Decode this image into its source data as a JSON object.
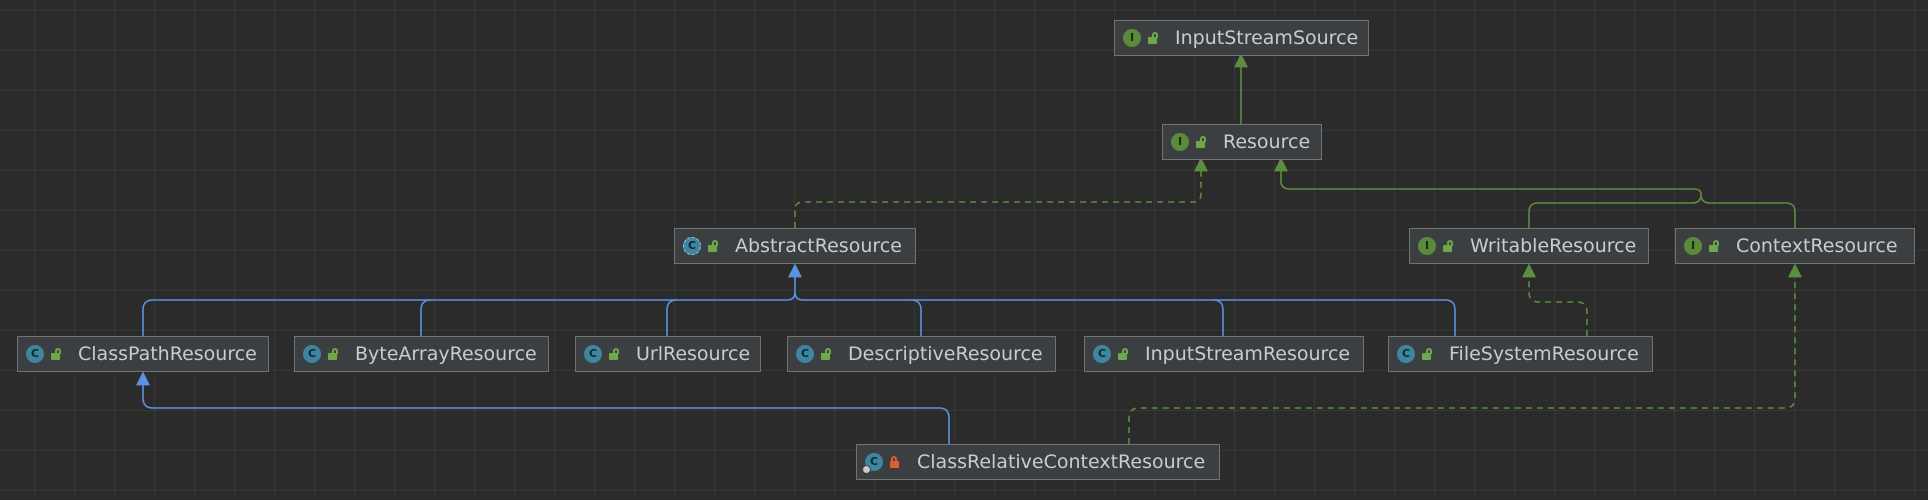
{
  "colors": {
    "background": "#2b2b2b",
    "node_fill": "#3c3f41",
    "node_border": "#727272",
    "text": "#c9ccce",
    "implements_edge": "#5b8f3f",
    "extends_edge": "#5a93e0",
    "interface_badge": "#5b8a3a",
    "class_badge": "#3e86a0",
    "public_lock": "#6ea84a",
    "private_lock": "#d9612e"
  },
  "legend_kinds": {
    "interface": {
      "badge_letter": "I",
      "icon": "interface-icon"
    },
    "class": {
      "badge_letter": "C",
      "icon": "class-icon"
    },
    "abstract": {
      "badge_letter": "C",
      "icon": "abstract-class-icon"
    },
    "inner": {
      "badge_letter": "C",
      "icon": "inner-class-icon"
    }
  },
  "nodes": [
    {
      "id": "inputstreamsource",
      "label": "InputStreamSource",
      "kind": "interface",
      "visibility": "public"
    },
    {
      "id": "resource",
      "label": "Resource",
      "kind": "interface",
      "visibility": "public"
    },
    {
      "id": "abstractresource",
      "label": "AbstractResource",
      "kind": "abstract",
      "visibility": "public"
    },
    {
      "id": "writableresource",
      "label": "WritableResource",
      "kind": "interface",
      "visibility": "public"
    },
    {
      "id": "contextresource",
      "label": "ContextResource",
      "kind": "interface",
      "visibility": "public"
    },
    {
      "id": "classpathresource",
      "label": "ClassPathResource",
      "kind": "class",
      "visibility": "public"
    },
    {
      "id": "bytearrayresource",
      "label": "ByteArrayResource",
      "kind": "class",
      "visibility": "public"
    },
    {
      "id": "urlresource",
      "label": "UrlResource",
      "kind": "class",
      "visibility": "public"
    },
    {
      "id": "descriptiveresource",
      "label": "DescriptiveResource",
      "kind": "class",
      "visibility": "public"
    },
    {
      "id": "inputstreamresource",
      "label": "InputStreamResource",
      "kind": "class",
      "visibility": "public"
    },
    {
      "id": "filesystemresource",
      "label": "FileSystemResource",
      "kind": "class",
      "visibility": "public"
    },
    {
      "id": "classrelativecontextresource",
      "label": "ClassRelativeContextResource",
      "kind": "inner",
      "visibility": "private"
    }
  ],
  "edges": [
    {
      "from": "resource",
      "to": "inputstreamsource",
      "type": "extends-interface"
    },
    {
      "from": "abstractresource",
      "to": "resource",
      "type": "implements"
    },
    {
      "from": "writableresource",
      "to": "resource",
      "type": "extends-interface"
    },
    {
      "from": "contextresource",
      "to": "resource",
      "type": "extends-interface"
    },
    {
      "from": "classpathresource",
      "to": "abstractresource",
      "type": "extends"
    },
    {
      "from": "bytearrayresource",
      "to": "abstractresource",
      "type": "extends"
    },
    {
      "from": "urlresource",
      "to": "abstractresource",
      "type": "extends"
    },
    {
      "from": "descriptiveresource",
      "to": "abstractresource",
      "type": "extends"
    },
    {
      "from": "inputstreamresource",
      "to": "abstractresource",
      "type": "extends"
    },
    {
      "from": "filesystemresource",
      "to": "abstractresource",
      "type": "extends"
    },
    {
      "from": "filesystemresource",
      "to": "writableresource",
      "type": "implements"
    },
    {
      "from": "classrelativecontextresource",
      "to": "classpathresource",
      "type": "extends"
    },
    {
      "from": "classrelativecontextresource",
      "to": "contextresource",
      "type": "implements"
    }
  ]
}
